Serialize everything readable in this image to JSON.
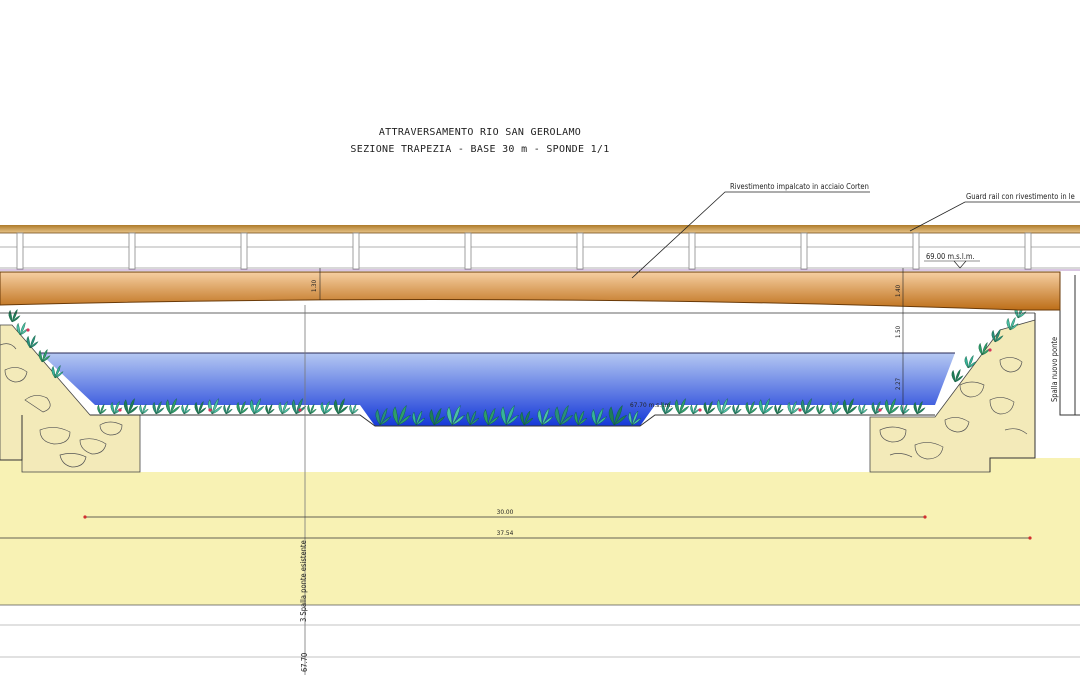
{
  "title": {
    "line1": "ATTRAVERSAMENTO RIO SAN GEROLAMO",
    "line2": "SEZIONE TRAPEZIA - BASE 30 m - SPONDE 1/1"
  },
  "annotations": {
    "deck_cladding": "Rivestimento impalcato in acciaio Corten",
    "guard_rail": "Guard rail con rivestimento in le",
    "deck_level": "69.00 m.s.l.m.",
    "water_level": "67.70 m.s.l.m.",
    "new_abutment": "Spalla nuovo ponte",
    "existing_abutment": "3  Spalla ponte esistente",
    "bottom_level": "67.70"
  },
  "dimensions": {
    "deck_thickness_left": "1.30",
    "deck_thickness_right": "1.40",
    "clearance": "1.50",
    "water_depth": "2.27",
    "base_width": "30.00",
    "total_width": "37.54"
  },
  "colors": {
    "deck_top": "#f6cfa2",
    "deck_bottom": "#bd6e18",
    "water_top": "#b5c8f2",
    "water_bottom": "#1438d8",
    "ground": "#f8f2b4",
    "stone": "#f3eab9",
    "dimension_marker": "#d23030"
  }
}
